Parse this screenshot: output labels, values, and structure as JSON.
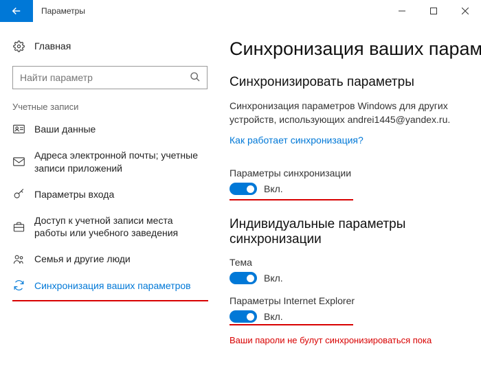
{
  "titlebar": {
    "title": "Параметры"
  },
  "sidebar": {
    "home": "Главная",
    "search_placeholder": "Найти параметр",
    "section": "Учетные записи",
    "items": [
      {
        "label": "Ваши данные"
      },
      {
        "label": "Адреса электронной почты; учетные записи приложений"
      },
      {
        "label": "Параметры входа"
      },
      {
        "label": "Доступ к учетной записи места работы или учебного заведения"
      },
      {
        "label": "Семья и другие люди"
      },
      {
        "label": "Синхронизация ваших параметров"
      }
    ]
  },
  "content": {
    "h1": "Синхронизация ваших параме",
    "h2a": "Синхронизировать параметры",
    "desc": "Синхронизация параметров Windows для других устройств, использующих andrei1445@yandex.ru.",
    "link": "Как работает синхронизация?",
    "master_label": "Параметры синхронизации",
    "on": "Вкл.",
    "h2b": "Индивидуальные параметры синхронизации",
    "theme_label": "Тема",
    "ie_label": "Параметры Internet Explorer",
    "warning": "Ваши пароли не булут синхронизироваться  пока"
  }
}
